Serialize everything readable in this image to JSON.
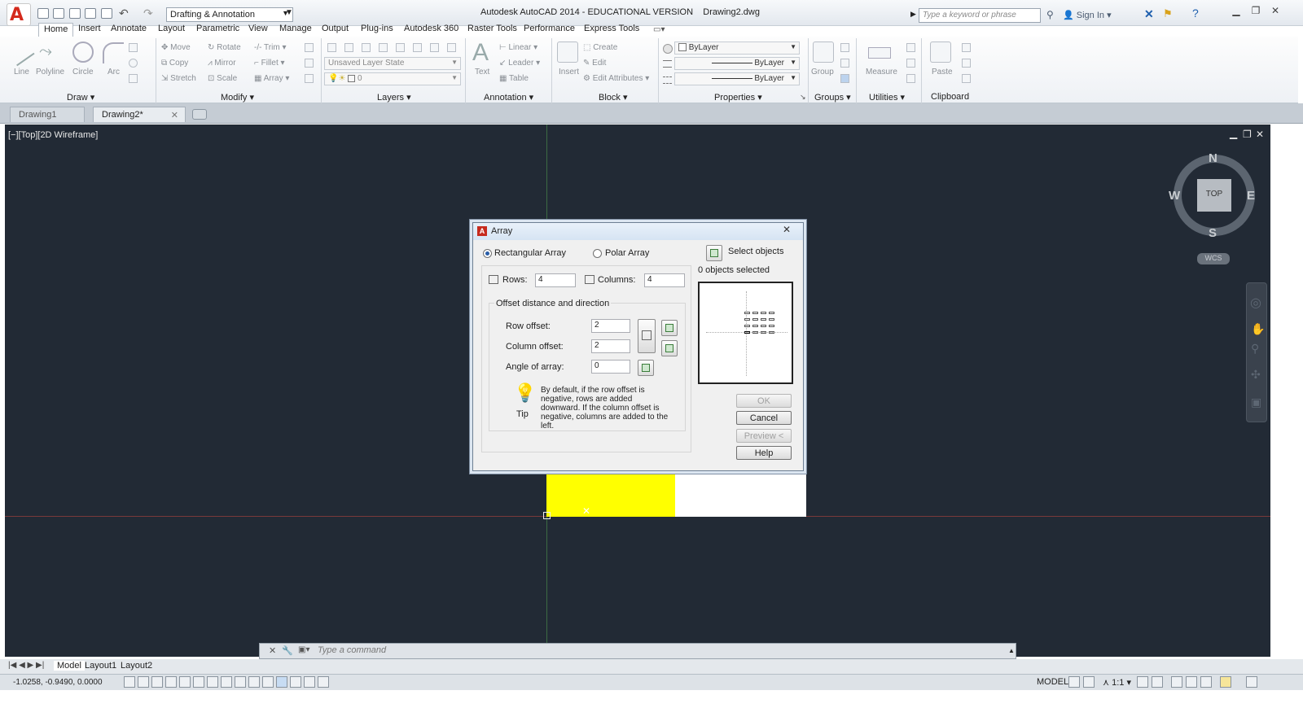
{
  "app": {
    "title": "Autodesk AutoCAD 2014 - EDUCATIONAL VERSION",
    "file": "Drawing2.dwg",
    "workspace": "Drafting & Annotation",
    "search_placeholder": "Type a keyword or phrase",
    "sign_in": "Sign In"
  },
  "ribbon_tabs": [
    "Home",
    "Insert",
    "Annotate",
    "Layout",
    "Parametric",
    "View",
    "Manage",
    "Output",
    "Plug-ins",
    "Autodesk 360",
    "Raster Tools",
    "Performance",
    "Express Tools"
  ],
  "draw": {
    "title": "Draw",
    "line": "Line",
    "polyline": "Polyline",
    "circle": "Circle",
    "arc": "Arc"
  },
  "modify": {
    "title": "Modify",
    "move": "Move",
    "rotate": "Rotate",
    "trim": "Trim",
    "copy": "Copy",
    "mirror": "Mirror",
    "fillet": "Fillet",
    "stretch": "Stretch",
    "scale": "Scale",
    "array": "Array"
  },
  "layers": {
    "title": "Layers",
    "layer_state": "Unsaved Layer State",
    "current_layer": "0"
  },
  "annotation": {
    "title": "Annotation",
    "text": "Text",
    "linear": "Linear",
    "leader": "Leader",
    "table": "Table"
  },
  "block": {
    "title": "Block",
    "insert": "Insert",
    "create": "Create",
    "edit": "Edit",
    "edit_attributes": "Edit Attributes"
  },
  "properties": {
    "title": "Properties",
    "color": "ByLayer",
    "linetype": "ByLayer",
    "lineweight": "ByLayer"
  },
  "groups": {
    "title": "Groups",
    "group": "Group"
  },
  "utilities": {
    "title": "Utilities",
    "measure": "Measure"
  },
  "clipboard": {
    "title": "Clipboard",
    "paste": "Paste"
  },
  "doc_tabs": [
    "Drawing1",
    "Drawing2*"
  ],
  "viewport": {
    "label": "[−][Top][2D Wireframe]"
  },
  "viewcube": {
    "top": "TOP",
    "north": "N",
    "south": "S",
    "east": "E",
    "west": "W",
    "wcs": "WCS"
  },
  "command": {
    "placeholder": "Type  a  command"
  },
  "layout_tabs": [
    "Model",
    "Layout1",
    "Layout2"
  ],
  "status": {
    "coords": "-1.0258, -0.9490, 0.0000",
    "model": "MODEL",
    "scale": "1:1"
  },
  "dialog": {
    "title": "Array",
    "rectangular": "Rectangular Array",
    "polar": "Polar Array",
    "select_objects": "Select objects",
    "selected_count": "0 objects selected",
    "rows_label": "Rows:",
    "rows_value": "4",
    "columns_label": "Columns:",
    "columns_value": "4",
    "offset_group": "Offset distance and direction",
    "row_offset_label": "Row offset:",
    "row_offset_value": "2",
    "column_offset_label": "Column offset:",
    "column_offset_value": "2",
    "angle_label": "Angle of array:",
    "angle_value": "0",
    "tip_label": "Tip",
    "tip_text": "By default, if the row offset is negative, rows are added downward.  If the column offset is negative, columns are added to the left.",
    "ok": "OK",
    "cancel": "Cancel",
    "preview": "Preview <",
    "help": "Help"
  },
  "colors": {
    "canvas": "#222a35",
    "highlight": "#ffff00",
    "accent": "#c62b1e"
  }
}
